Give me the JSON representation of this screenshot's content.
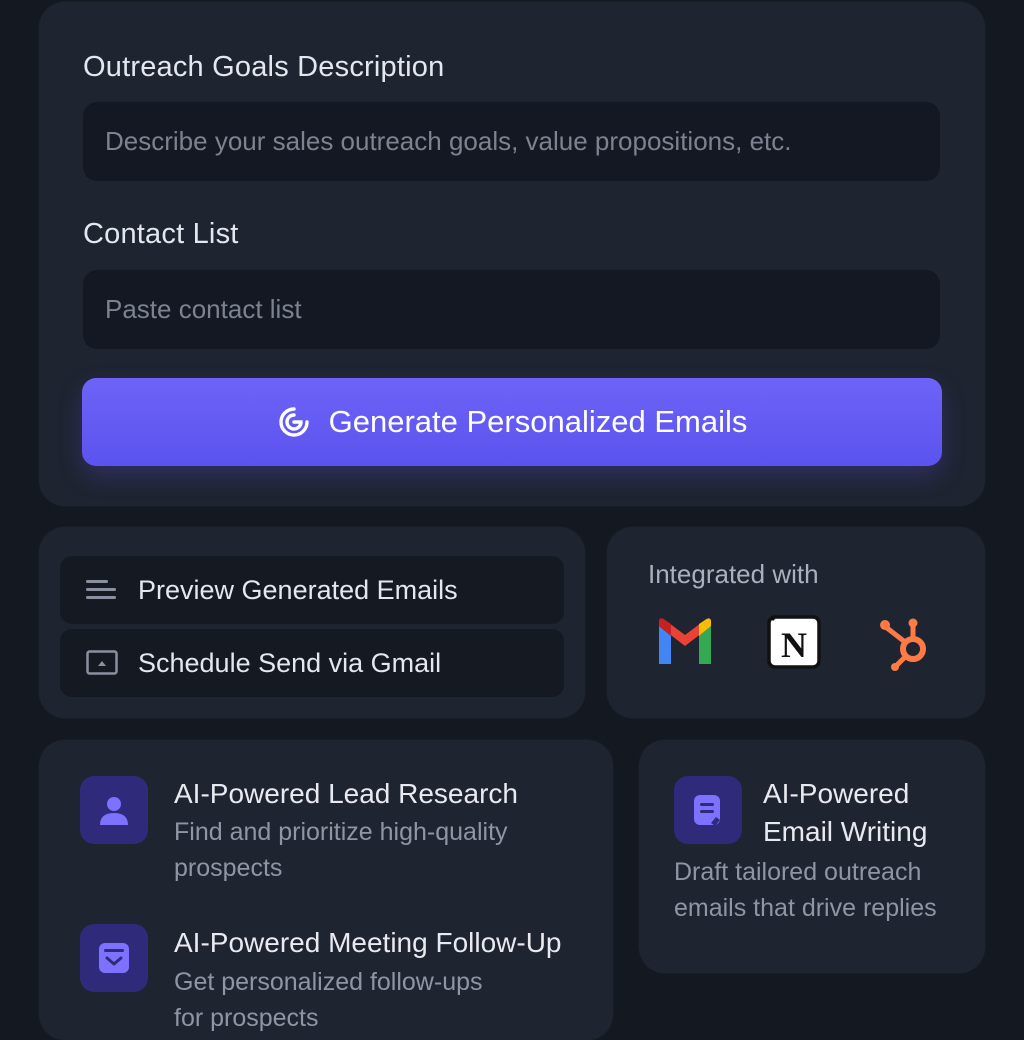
{
  "form": {
    "goals_label": "Outreach Goals Description",
    "goals_placeholder": "Describe your sales outreach goals, value propositions, etc.",
    "contacts_label": "Contact List",
    "contacts_placeholder": "Paste contact list",
    "generate_button": "Generate Personalized Emails"
  },
  "actions": [
    {
      "label": "Preview Generated Emails",
      "icon": "list-icon"
    },
    {
      "label": "Schedule Send via Gmail",
      "icon": "monitor-icon"
    }
  ],
  "integrations": {
    "label": "Integrated with",
    "logos": [
      "gmail-logo",
      "notion-logo",
      "hubspot-logo"
    ]
  },
  "features": [
    {
      "title": "AI-Powered Lead Research",
      "desc_line1": "Find and prioritize high-quality",
      "desc_line2": "prospects",
      "icon": "user-icon"
    },
    {
      "title": "AI-Powered Meeting Follow-Up",
      "desc_line1": "Get personalized follow-ups",
      "desc_line2": "for prospects",
      "icon": "inbox-download-icon"
    },
    {
      "title_line1": "AI-Powered",
      "title_line2": "Email Writing",
      "desc_line1": "Draft tailored outreach",
      "desc_line2": "emails that drive replies",
      "icon": "document-edit-icon"
    }
  ],
  "colors": {
    "background": "#141820",
    "card": "#1f2431",
    "accent": "#6259f2",
    "icon_tile": "#2f2b7a"
  }
}
